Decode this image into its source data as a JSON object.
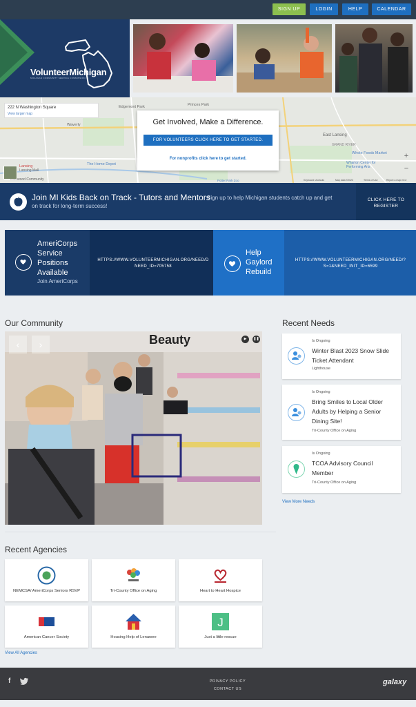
{
  "topnav": {
    "signup": "SIGN UP",
    "login": "LOGIN",
    "help": "HELP",
    "calendar": "CALENDAR"
  },
  "brand": {
    "name": "VolunteerMichigan",
    "tagline": "MICHIGAN COMMUNITY SERVICE COMMISSION"
  },
  "map": {
    "address": "222 N Washington Square",
    "larger_map": "View larger map",
    "places": [
      "Edgemont Park",
      "Princes Park",
      "Waverly",
      "Lansing",
      "The Home Depot",
      "East Lansing",
      "GRAND RIVER",
      "Whole Foods Market",
      "Wharton Center for Performing Arts",
      "Lansing Mall",
      "Potter Park Zoo",
      "Eastwood Community"
    ],
    "credits": [
      "Keyboard shortcuts",
      "Map data ©2023",
      "Terms of Use",
      "Report a map error"
    ]
  },
  "callout": {
    "title": "Get Involved, Make a Difference.",
    "volunteer_button": "FOR VOLUNTEERS CLICK HERE TO GET STARTED.",
    "nonprofit_link": "For nonprofits click here to get started."
  },
  "banner": {
    "title": "Join MI Kids Back on Track - Tutors and Mentors",
    "subtitle_line1": "Sign up to help Michigan students catch up and get",
    "subtitle_line2": "on track for long-term success!",
    "button_line1": "CLICK HERE TO",
    "button_line2": "REGISTER"
  },
  "features": {
    "americorps": {
      "title_lines": [
        "AmeriCorps",
        "Service",
        "Positions",
        "Available"
      ],
      "subtitle": "Join AmeriCorps",
      "url_line1": "HTTPS://WWW.VOLUNTEERMICHIGAN.ORG/NEED/D",
      "url_line2": "NEED_ID=705758"
    },
    "gaylord": {
      "title_lines": [
        "Help",
        "Gaylord",
        "Rebuild"
      ],
      "url_line1": "HTTPS://WWW.VOLUNTEERMICHIGAN.ORG/NEED/?",
      "url_line2": "S=1&NEED_INIT_ID=6599"
    }
  },
  "community": {
    "title": "Our Community",
    "photo_sign": "Beauty"
  },
  "needs": {
    "title": "Recent Needs",
    "items": [
      {
        "status": "Is Ongoing",
        "title_lines": [
          "Winter Blast 2023 Snow Slide",
          "Ticket Attendant"
        ],
        "org": "Lighthouse"
      },
      {
        "status": "Is Ongoing",
        "title_lines": [
          "Bring Smiles to Local Older",
          "Adults by Helping a Senior",
          "Dining Site!"
        ],
        "org": "Tri-County Office on Aging"
      },
      {
        "status": "Is Ongoing",
        "title_lines": [
          "TCOA Advisory Council",
          "Member"
        ],
        "org": "Tri-County Office on Aging"
      }
    ],
    "view_more": "View More Needs"
  },
  "agencies": {
    "title": "Recent Agencies",
    "items": [
      {
        "name": "NEMCSA/ AmeriCorps Seniors RSVP",
        "icon": "nemcsa-logo"
      },
      {
        "name": "Tri-County Office on Aging",
        "icon": "tcoa-logo"
      },
      {
        "name": "Heart to Heart Hospice",
        "icon": "hospice-logo"
      },
      {
        "name": "American Cancer Society",
        "icon": "acs-logo"
      },
      {
        "name": "Housing Help of Lenawee",
        "icon": "house-logo"
      },
      {
        "name": "Just a little rescue",
        "icon": "j-logo"
      }
    ],
    "view_all": "View All Agencies"
  },
  "footer": {
    "privacy": "PRIVACY POLICY",
    "contact": "CONTACT US",
    "social": [
      "f",
      "twitter"
    ],
    "logo": "galaxy"
  },
  "colors": {
    "topbar": "#2d3e50",
    "signup_green": "#8cbf4f",
    "nav_blue": "#1e6fc0",
    "navy": "#1a3b68",
    "footer": "#3a3b3f"
  }
}
